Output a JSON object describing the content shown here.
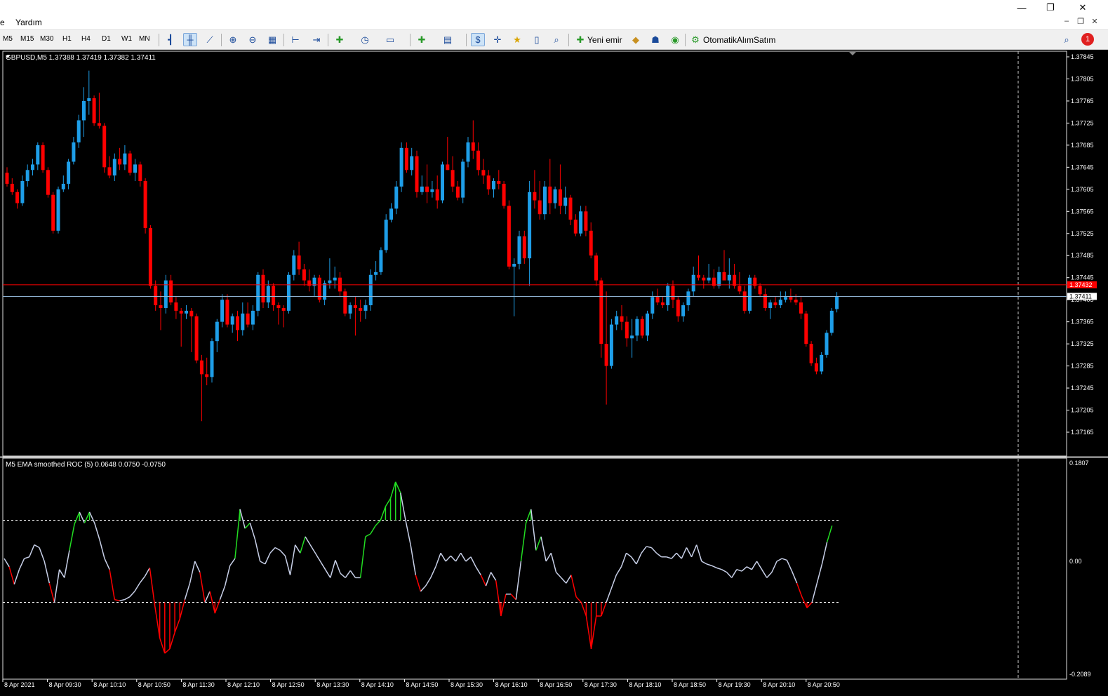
{
  "menu": {
    "items": [
      "e",
      "Yardım"
    ]
  },
  "window_controls": {
    "minimize": "—",
    "restore": "❐",
    "close": "✕",
    "mdi_minimize": "–",
    "mdi_restore": "❐",
    "mdi_close": "✕"
  },
  "toolbar": {
    "timeframes": [
      "M5",
      "M15",
      "M30",
      "H1",
      "H4",
      "D1",
      "W1",
      "MN"
    ],
    "new_order_label": "Yeni emir",
    "autotrading_label": "OtomatikAlımSatım",
    "notification_count": "1"
  },
  "chart": {
    "info_line": "GBPUSD,M5  1.37388 1.37419 1.37382 1.37411",
    "price_labels": [
      "1.37845",
      "1.37805",
      "1.37765",
      "1.37725",
      "1.37685",
      "1.37645",
      "1.37605",
      "1.37565",
      "1.37525",
      "1.37485",
      "1.37445",
      "1.37405",
      "1.37365",
      "1.37325",
      "1.37285",
      "1.37245",
      "1.37205",
      "1.37165"
    ],
    "ask_label": "1.37432",
    "bid_label": "1.37411",
    "time_labels": [
      "8 Apr 2021",
      "8 Apr 09:30",
      "8 Apr 10:10",
      "8 Apr 10:50",
      "8 Apr 11:30",
      "8 Apr 12:10",
      "8 Apr 12:50",
      "8 Apr 13:30",
      "8 Apr 14:10",
      "8 Apr 14:50",
      "8 Apr 15:30",
      "8 Apr 16:10",
      "8 Apr 16:50",
      "8 Apr 17:30",
      "8 Apr 18:10",
      "8 Apr 18:50",
      "8 Apr 19:30",
      "8 Apr 20:10",
      "8 Apr 20:50"
    ],
    "colors": {
      "bull": "#1e9ee8",
      "bear": "#ff0000",
      "ask_line": "#ff0000",
      "bid_line": "#8fb3d3"
    }
  },
  "indicator": {
    "info_line": "M5 EMA smoothed ROC (5) 0.0648 0.0750 -0.0750",
    "labels": {
      "top": "0.1807",
      "zero": "0.00",
      "bottom": "-0.2089"
    },
    "levels": [
      0.075,
      -0.075
    ],
    "colors": {
      "line": "#c8d0e8",
      "up": "#22dd22",
      "down": "#ff0000"
    }
  },
  "chart_data": {
    "type": "candlestick",
    "symbol": "GBPUSD",
    "timeframe": "M5",
    "ylim": [
      1.37165,
      1.37845
    ],
    "candles_ohlc": [
      [
        1.37635,
        1.37645,
        1.3761,
        1.37615
      ],
      [
        1.37615,
        1.37625,
        1.37595,
        1.376
      ],
      [
        1.376,
        1.37605,
        1.3757,
        1.3758
      ],
      [
        1.3758,
        1.3763,
        1.37575,
        1.3762
      ],
      [
        1.3762,
        1.3765,
        1.3761,
        1.3764
      ],
      [
        1.3764,
        1.3766,
        1.3763,
        1.3765
      ],
      [
        1.3765,
        1.3769,
        1.3764,
        1.37685
      ],
      [
        1.37685,
        1.3769,
        1.37635,
        1.3764
      ],
      [
        1.3764,
        1.37645,
        1.3759,
        1.37595
      ],
      [
        1.37595,
        1.376,
        1.37525,
        1.3753
      ],
      [
        1.3753,
        1.3761,
        1.37525,
        1.37605
      ],
      [
        1.37605,
        1.3763,
        1.376,
        1.37615
      ],
      [
        1.37615,
        1.3766,
        1.37605,
        1.37655
      ],
      [
        1.37655,
        1.377,
        1.3765,
        1.3769
      ],
      [
        1.3769,
        1.3774,
        1.3768,
        1.3773
      ],
      [
        1.3773,
        1.3779,
        1.377,
        1.37765
      ],
      [
        1.37765,
        1.3782,
        1.3774,
        1.3777
      ],
      [
        1.3777,
        1.37775,
        1.3772,
        1.37725
      ],
      [
        1.37725,
        1.3778,
        1.37715,
        1.3772
      ],
      [
        1.3772,
        1.37725,
        1.37635,
        1.37645
      ],
      [
        1.37645,
        1.37665,
        1.37625,
        1.3763
      ],
      [
        1.3763,
        1.3767,
        1.3762,
        1.3766
      ],
      [
        1.3766,
        1.3768,
        1.3764,
        1.3765
      ],
      [
        1.3765,
        1.37685,
        1.3764,
        1.3767
      ],
      [
        1.3767,
        1.37675,
        1.3763,
        1.37635
      ],
      [
        1.37635,
        1.3766,
        1.3762,
        1.3765
      ],
      [
        1.3765,
        1.37655,
        1.3761,
        1.3762
      ],
      [
        1.3762,
        1.37625,
        1.37525,
        1.37535
      ],
      [
        1.37535,
        1.3754,
        1.37425,
        1.3743
      ],
      [
        1.3743,
        1.3744,
        1.37385,
        1.37395
      ],
      [
        1.37395,
        1.3742,
        1.3735,
        1.3739
      ],
      [
        1.3739,
        1.3745,
        1.3738,
        1.3744
      ],
      [
        1.3744,
        1.3745,
        1.37395,
        1.374
      ],
      [
        1.374,
        1.3741,
        1.3737,
        1.37385
      ],
      [
        1.37385,
        1.3739,
        1.3732,
        1.3738
      ],
      [
        1.3738,
        1.37395,
        1.3737,
        1.37385
      ],
      [
        1.37385,
        1.3739,
        1.3731,
        1.37375
      ],
      [
        1.37375,
        1.3738,
        1.3729,
        1.37295
      ],
      [
        1.37295,
        1.37305,
        1.37185,
        1.3727
      ],
      [
        1.3727,
        1.373,
        1.3725,
        1.37265
      ],
      [
        1.37265,
        1.37335,
        1.37255,
        1.3733
      ],
      [
        1.3733,
        1.3737,
        1.3731,
        1.37365
      ],
      [
        1.37365,
        1.37415,
        1.37355,
        1.37405
      ],
      [
        1.37405,
        1.37415,
        1.37355,
        1.3736
      ],
      [
        1.3736,
        1.3738,
        1.37345,
        1.37375
      ],
      [
        1.37375,
        1.37385,
        1.3733,
        1.3735
      ],
      [
        1.3735,
        1.374,
        1.3734,
        1.3738
      ],
      [
        1.3738,
        1.374,
        1.37355,
        1.3736
      ],
      [
        1.3736,
        1.37395,
        1.3735,
        1.37385
      ],
      [
        1.37385,
        1.37455,
        1.37375,
        1.3745
      ],
      [
        1.3745,
        1.3746,
        1.3739,
        1.374
      ],
      [
        1.374,
        1.3744,
        1.3739,
        1.3743
      ],
      [
        1.3743,
        1.37435,
        1.37385,
        1.37395
      ],
      [
        1.37395,
        1.374,
        1.3736,
        1.3739
      ],
      [
        1.3739,
        1.37395,
        1.37355,
        1.37385
      ],
      [
        1.37385,
        1.37455,
        1.3738,
        1.3745
      ],
      [
        1.3745,
        1.37495,
        1.3744,
        1.37485
      ],
      [
        1.37485,
        1.3751,
        1.3745,
        1.3746
      ],
      [
        1.3746,
        1.3747,
        1.3743,
        1.3744
      ],
      [
        1.3744,
        1.3746,
        1.3742,
        1.3743
      ],
      [
        1.3743,
        1.3745,
        1.3741,
        1.37445
      ],
      [
        1.37445,
        1.3745,
        1.374,
        1.37405
      ],
      [
        1.37405,
        1.3744,
        1.37395,
        1.37435
      ],
      [
        1.37435,
        1.3748,
        1.37425,
        1.3744
      ],
      [
        1.3744,
        1.37465,
        1.37425,
        1.37445
      ],
      [
        1.37445,
        1.37455,
        1.3741,
        1.3742
      ],
      [
        1.3742,
        1.37425,
        1.37375,
        1.3738
      ],
      [
        1.3738,
        1.374,
        1.3737,
        1.37395
      ],
      [
        1.37395,
        1.3741,
        1.3734,
        1.3739
      ],
      [
        1.3739,
        1.37405,
        1.37365,
        1.37385
      ],
      [
        1.37385,
        1.37405,
        1.3737,
        1.37395
      ],
      [
        1.37395,
        1.3746,
        1.37385,
        1.3745
      ],
      [
        1.3745,
        1.37475,
        1.3744,
        1.37455
      ],
      [
        1.37455,
        1.375,
        1.3745,
        1.37495
      ],
      [
        1.37495,
        1.3756,
        1.3749,
        1.3755
      ],
      [
        1.3755,
        1.3758,
        1.37545,
        1.3757
      ],
      [
        1.3757,
        1.3762,
        1.3756,
        1.3761
      ],
      [
        1.3761,
        1.3769,
        1.376,
        1.3768
      ],
      [
        1.3768,
        1.3769,
        1.37635,
        1.3764
      ],
      [
        1.3764,
        1.3768,
        1.3763,
        1.37665
      ],
      [
        1.37665,
        1.37675,
        1.3759,
        1.376
      ],
      [
        1.376,
        1.3763,
        1.37595,
        1.3761
      ],
      [
        1.3761,
        1.3765,
        1.3758,
        1.376
      ],
      [
        1.376,
        1.3762,
        1.3759,
        1.37605
      ],
      [
        1.37605,
        1.3763,
        1.3757,
        1.37585
      ],
      [
        1.37585,
        1.37655,
        1.3758,
        1.3765
      ],
      [
        1.3765,
        1.377,
        1.3764,
        1.3764
      ],
      [
        1.3764,
        1.37665,
        1.376,
        1.3761
      ],
      [
        1.3761,
        1.3762,
        1.37585,
        1.3759
      ],
      [
        1.3759,
        1.3766,
        1.3758,
        1.37655
      ],
      [
        1.37655,
        1.377,
        1.37645,
        1.3769
      ],
      [
        1.3769,
        1.3773,
        1.3766,
        1.37675
      ],
      [
        1.37675,
        1.3769,
        1.3763,
        1.3764
      ],
      [
        1.3764,
        1.3766,
        1.37615,
        1.3763
      ],
      [
        1.3763,
        1.3764,
        1.37595,
        1.37605
      ],
      [
        1.37605,
        1.37625,
        1.3759,
        1.3762
      ],
      [
        1.3762,
        1.3764,
        1.37605,
        1.37615
      ],
      [
        1.37615,
        1.3762,
        1.3757,
        1.37575
      ],
      [
        1.37575,
        1.37585,
        1.3746,
        1.37465
      ],
      [
        1.37465,
        1.3748,
        1.37375,
        1.3747
      ],
      [
        1.3747,
        1.3753,
        1.3746,
        1.3752
      ],
      [
        1.3752,
        1.3753,
        1.3747,
        1.3748
      ],
      [
        1.3748,
        1.3762,
        1.3743,
        1.376
      ],
      [
        1.376,
        1.3764,
        1.3757,
        1.37585
      ],
      [
        1.37585,
        1.3762,
        1.3755,
        1.3756
      ],
      [
        1.3756,
        1.3762,
        1.3755,
        1.3761
      ],
      [
        1.3761,
        1.3766,
        1.3756,
        1.3758
      ],
      [
        1.3758,
        1.3761,
        1.3757,
        1.37605
      ],
      [
        1.37605,
        1.3765,
        1.3756,
        1.37575
      ],
      [
        1.37575,
        1.3761,
        1.3756,
        1.3759
      ],
      [
        1.3759,
        1.37595,
        1.3754,
        1.3755
      ],
      [
        1.3755,
        1.3756,
        1.3752,
        1.37525
      ],
      [
        1.37525,
        1.37575,
        1.3752,
        1.37565
      ],
      [
        1.37565,
        1.37575,
        1.3752,
        1.3753
      ],
      [
        1.3753,
        1.37545,
        1.3748,
        1.37485
      ],
      [
        1.37485,
        1.3749,
        1.3743,
        1.3744
      ],
      [
        1.3744,
        1.37445,
        1.373,
        1.37325
      ],
      [
        1.37325,
        1.3742,
        1.37215,
        1.37285
      ],
      [
        1.37285,
        1.3737,
        1.3728,
        1.3736
      ],
      [
        1.3736,
        1.37385,
        1.3735,
        1.37375
      ],
      [
        1.37375,
        1.37395,
        1.3735,
        1.37365
      ],
      [
        1.37365,
        1.37375,
        1.3732,
        1.37335
      ],
      [
        1.37335,
        1.3737,
        1.373,
        1.3734
      ],
      [
        1.3734,
        1.37375,
        1.3733,
        1.3737
      ],
      [
        1.3737,
        1.37375,
        1.37335,
        1.3734
      ],
      [
        1.3734,
        1.37385,
        1.3733,
        1.3738
      ],
      [
        1.3738,
        1.3742,
        1.3737,
        1.3741
      ],
      [
        1.3741,
        1.37425,
        1.37395,
        1.374
      ],
      [
        1.374,
        1.3741,
        1.3739,
        1.37395
      ],
      [
        1.37395,
        1.37435,
        1.37385,
        1.3743
      ],
      [
        1.3743,
        1.3744,
        1.3739,
        1.37405
      ],
      [
        1.37405,
        1.3741,
        1.37365,
        1.37375
      ],
      [
        1.37375,
        1.374,
        1.37365,
        1.37395
      ],
      [
        1.37395,
        1.37425,
        1.37385,
        1.3742
      ],
      [
        1.3742,
        1.37465,
        1.3741,
        1.3745
      ],
      [
        1.3745,
        1.37485,
        1.3744,
        1.37445
      ],
      [
        1.37445,
        1.3745,
        1.37425,
        1.3744
      ],
      [
        1.3744,
        1.3747,
        1.37435,
        1.37445
      ],
      [
        1.37445,
        1.3746,
        1.37425,
        1.3743
      ],
      [
        1.3743,
        1.37465,
        1.37425,
        1.37455
      ],
      [
        1.37455,
        1.37495,
        1.37445,
        1.3744
      ],
      [
        1.3744,
        1.3748,
        1.37425,
        1.3745
      ],
      [
        1.3745,
        1.3747,
        1.37425,
        1.3743
      ],
      [
        1.3743,
        1.37455,
        1.37415,
        1.3742
      ],
      [
        1.3742,
        1.3743,
        1.3738,
        1.37385
      ],
      [
        1.37385,
        1.3745,
        1.3738,
        1.37445
      ],
      [
        1.37445,
        1.3745,
        1.37425,
        1.3743
      ],
      [
        1.3743,
        1.37435,
        1.3741,
        1.37415
      ],
      [
        1.37415,
        1.37425,
        1.37385,
        1.3739
      ],
      [
        1.3739,
        1.37405,
        1.3737,
        1.374
      ],
      [
        1.374,
        1.3741,
        1.3739,
        1.37395
      ],
      [
        1.37395,
        1.3742,
        1.3739,
        1.37405
      ],
      [
        1.37405,
        1.3742,
        1.374,
        1.3741
      ],
      [
        1.3741,
        1.37425,
        1.374,
        1.37405
      ],
      [
        1.37405,
        1.37415,
        1.37395,
        1.374
      ],
      [
        1.374,
        1.3741,
        1.3737,
        1.3738
      ],
      [
        1.3738,
        1.37385,
        1.3732,
        1.37325
      ],
      [
        1.37325,
        1.3733,
        1.37285,
        1.3729
      ],
      [
        1.3729,
        1.373,
        1.3727,
        1.37275
      ],
      [
        1.37275,
        1.3731,
        1.3727,
        1.37305
      ],
      [
        1.37305,
        1.3735,
        1.373,
        1.37345
      ],
      [
        1.37345,
        1.3739,
        1.3734,
        1.37385
      ],
      [
        1.37388,
        1.37419,
        1.37382,
        1.37411
      ]
    ],
    "roc_values": [
      0.005,
      -0.01,
      -0.042,
      -0.015,
      0.005,
      0.008,
      0.03,
      0.025,
      0.0,
      -0.04,
      -0.075,
      -0.015,
      -0.03,
      0.02,
      0.068,
      0.09,
      0.07,
      0.09,
      0.07,
      0.04,
      0.005,
      -0.015,
      -0.07,
      -0.072,
      -0.07,
      -0.065,
      -0.055,
      -0.04,
      -0.028,
      -0.012,
      -0.08,
      -0.14,
      -0.168,
      -0.16,
      -0.13,
      -0.105,
      -0.07,
      -0.04,
      0.0,
      -0.02,
      -0.075,
      -0.055,
      -0.095,
      -0.07,
      -0.045,
      -0.008,
      0.005,
      0.095,
      0.06,
      0.07,
      0.04,
      0.0,
      -0.005,
      0.015,
      0.025,
      0.02,
      0.01,
      -0.025,
      0.03,
      0.015,
      0.045,
      0.03,
      0.015,
      0.0,
      -0.015,
      -0.03,
      0.002,
      -0.022,
      -0.03,
      -0.017,
      -0.03,
      -0.03,
      0.045,
      0.05,
      0.065,
      0.075,
      0.1,
      0.115,
      0.145,
      0.125,
      0.075,
      0.03,
      -0.025,
      -0.055,
      -0.045,
      -0.03,
      -0.01,
      0.015,
      0.0,
      0.01,
      0.0,
      0.015,
      0.0,
      0.008,
      -0.01,
      -0.025,
      -0.045,
      -0.02,
      -0.035,
      -0.1,
      -0.06,
      -0.06,
      -0.07,
      0.0,
      0.07,
      0.095,
      0.02,
      0.045,
      0.0,
      0.015,
      -0.02,
      -0.03,
      -0.04,
      -0.025,
      -0.065,
      -0.075,
      -0.1,
      -0.16,
      -0.1,
      -0.1,
      -0.075,
      -0.05,
      -0.025,
      -0.01,
      0.015,
      0.008,
      -0.005,
      0.015,
      0.027,
      0.025,
      0.015,
      0.008,
      0.008,
      0.005,
      0.015,
      0.005,
      0.025,
      0.008,
      0.03,
      0.0,
      -0.005,
      -0.008,
      -0.012,
      -0.015,
      -0.02,
      -0.03,
      -0.015,
      -0.018,
      -0.01,
      -0.015,
      0.0,
      -0.015,
      -0.03,
      -0.02,
      0.0,
      0.005,
      0.002,
      -0.018,
      -0.04,
      -0.065,
      -0.085,
      -0.075,
      -0.04,
      -0.005,
      0.035,
      0.065
    ]
  }
}
